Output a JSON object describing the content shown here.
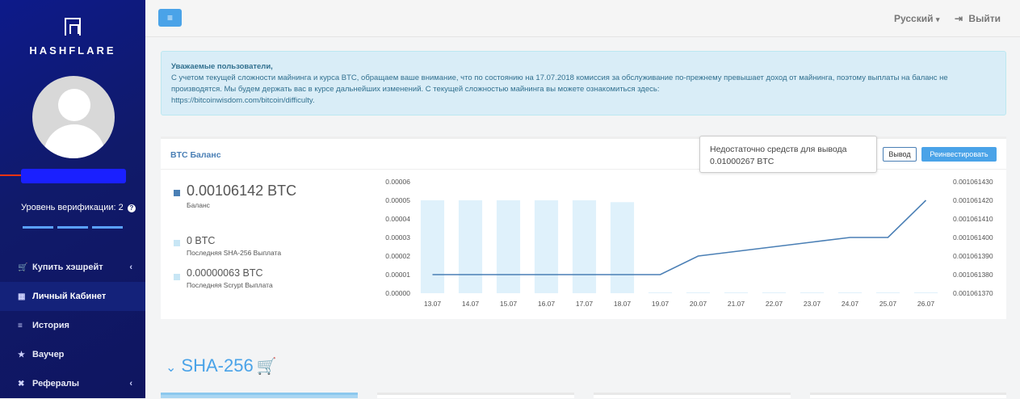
{
  "sidebar": {
    "logo": "HASHFLARE",
    "verification": "Уровень верификации: 2",
    "menu": [
      {
        "label": "Купить хэшрейт",
        "icon": "cart-icon",
        "glyph": "🛒",
        "chevron": "‹"
      },
      {
        "label": "Личный Кабинет",
        "icon": "dashboard-icon",
        "glyph": "▦",
        "active": true
      },
      {
        "label": "История",
        "icon": "list-icon",
        "glyph": "≡"
      },
      {
        "label": "Ваучер",
        "icon": "star-icon",
        "glyph": "★"
      },
      {
        "label": "Рефералы",
        "icon": "network-icon",
        "glyph": "✖",
        "chevron": "‹"
      }
    ]
  },
  "topbar": {
    "language": "Русский",
    "logout": "Выйти"
  },
  "alert": {
    "title": "Уважаемые пользователи,",
    "body": "С учетом текущей сложности майнинга и курса BTC, обращаем ваше внимание, что по состоянию на 17.07.2018 комиссия за обслуживание по-прежнему превышает доход от майнинга, поэтому выплаты на баланс не производятся. Мы будем держать вас в курсе дальнейших изменений. С текущей сложностью майнинга вы можете ознакомиться здесь:",
    "link": "https://bitcoinwisdom.com/bitcoin/difficulty."
  },
  "panel": {
    "title": "BTC Баланс",
    "tooltip_line1": "Недостаточно средств для вывода",
    "tooltip_line2": "0.01000267 BTC",
    "withdraw_label": "Вывод",
    "reinvest_label": "Реинвестировать",
    "balance_value": "0.00106142 BTC",
    "balance_label": "Баланс",
    "sha_value": "0 BTC",
    "sha_label": "Последняя SHA-256 Выплата",
    "scrypt_value": "0.00000063 BTC",
    "scrypt_label": "Последняя Scrypt Выплата"
  },
  "colors": {
    "balance": "#4a7fb5",
    "payout": "#c8e6f5",
    "accent": "#4aa3e8"
  },
  "section": {
    "title": "SHA-256"
  },
  "chart_data": {
    "type": "bar",
    "categories": [
      "13.07",
      "14.07",
      "15.07",
      "16.07",
      "17.07",
      "18.07",
      "19.07",
      "20.07",
      "21.07",
      "22.07",
      "23.07",
      "24.07",
      "25.07",
      "26.07"
    ],
    "series": [
      {
        "type": "bar",
        "axis": "left",
        "values": [
          5e-05,
          5e-05,
          5e-05,
          5e-05,
          5e-05,
          4.9e-05,
          0,
          0,
          0,
          0,
          0,
          0,
          0,
          0
        ]
      },
      {
        "type": "line",
        "axis": "right",
        "values": [
          0.00106138,
          0.00106138,
          0.00106138,
          0.00106138,
          0.00106138,
          0.00106138,
          0.00106138,
          0.00106139,
          0.0010613925,
          0.001061395,
          0.0010613975,
          0.0010614,
          0.0010614,
          0.00106142
        ]
      }
    ],
    "yticks_left": [
      "0.00006",
      "0.00005",
      "0.00004",
      "0.00003",
      "0.00002",
      "0.00001",
      "0.00000"
    ],
    "yticks_right": [
      "0.001061430",
      "0.001061420",
      "0.001061410",
      "0.001061400",
      "0.001061390",
      "0.001061380",
      "0.001061370"
    ],
    "ylim_left": [
      0,
      6e-05
    ],
    "ylim_right": [
      0.00106137,
      0.00106143
    ],
    "grid": false
  }
}
